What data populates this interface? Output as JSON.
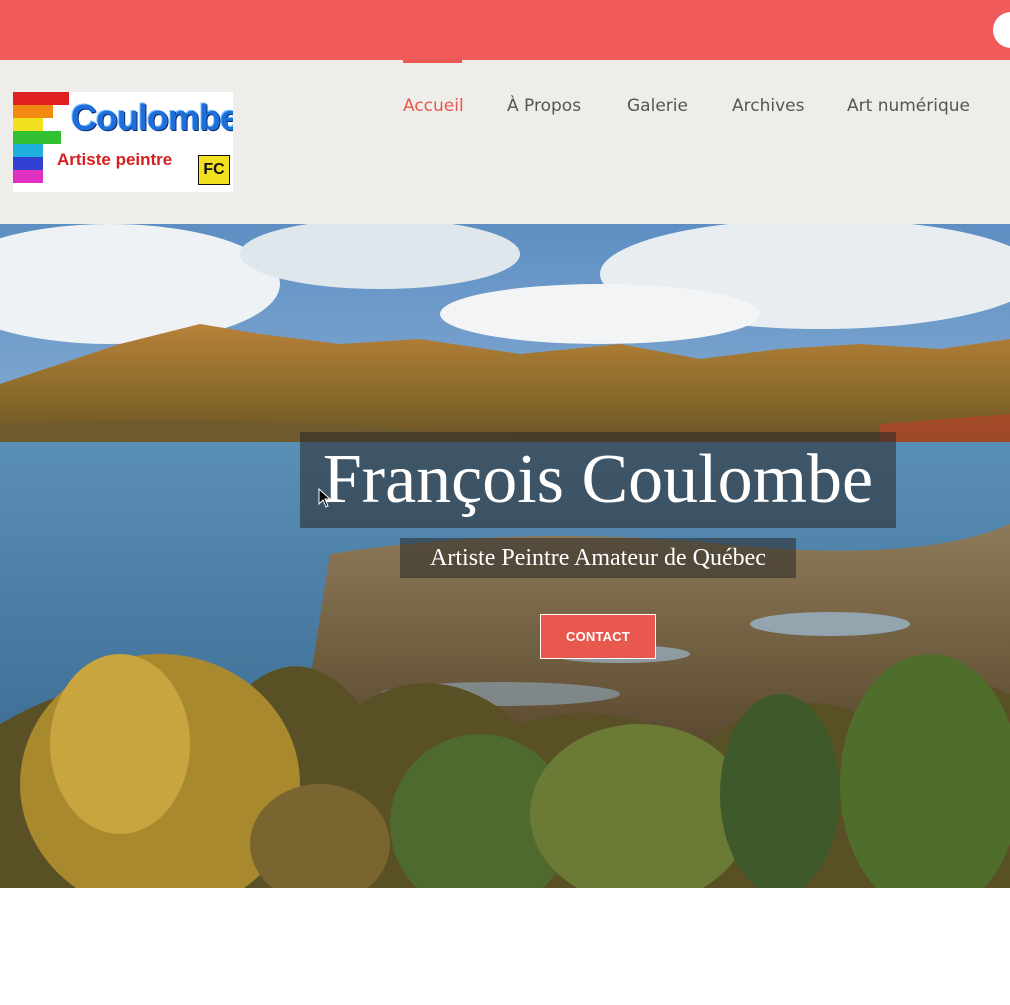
{
  "topbar": {
    "accent_color": "#f05a5a",
    "right_button_icon": "circle-icon"
  },
  "logo": {
    "title": "Coulombe",
    "subtitle": "Artiste peintre",
    "badge": "FC"
  },
  "nav": {
    "items": [
      {
        "label": "Accueil",
        "active": true
      },
      {
        "label": "À Propos",
        "active": false
      },
      {
        "label": "Galerie",
        "active": false
      },
      {
        "label": "Archives",
        "active": false
      },
      {
        "label": "Art numérique",
        "active": false
      }
    ],
    "active_color": "#e8584f"
  },
  "hero": {
    "title": "François Coulombe",
    "subtitle": "Artiste Peintre Amateur de Québec",
    "button_label": "CONTACT"
  }
}
